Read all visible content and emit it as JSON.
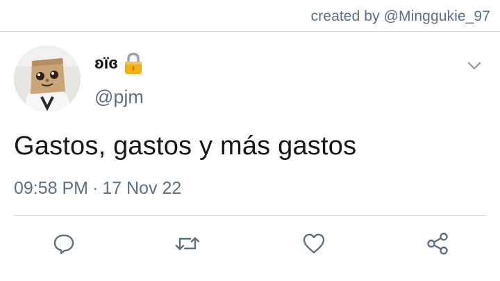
{
  "credit": "created by @Minggukie_97",
  "tweet": {
    "display_name": "ʚïɞ",
    "handle": "@pjm",
    "text": "Gastos, gastos y más gastos",
    "time": "09:58 PM",
    "separator": "·",
    "date": "17 Nov 22"
  },
  "icons": {
    "lock": "lock-icon",
    "chevron": "chevron-down-icon",
    "reply": "reply-icon",
    "retweet": "retweet-icon",
    "like": "heart-icon",
    "share": "share-icon"
  },
  "colors": {
    "text_primary": "#14171a",
    "text_secondary": "#5b7083",
    "divider": "#d3dae0",
    "lock_gold": "#f2b21b"
  }
}
